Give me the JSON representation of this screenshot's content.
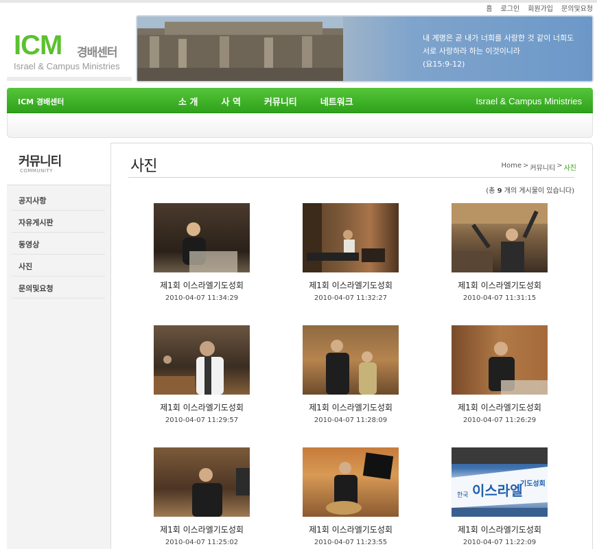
{
  "top_links": [
    "홈",
    "로그인",
    "회원가입",
    "문의및요청"
  ],
  "logo": {
    "main": "ICM",
    "korean": "경배센터",
    "english": "Israel & Campus Ministries"
  },
  "banner": {
    "verse_line1": "내 계명은 곧 내가 너희를 사랑한 것 같이 너희도",
    "verse_line2": "서로 사랑하라 하는 이것이니라",
    "verse_ref": "(요15:9-12)"
  },
  "nav": {
    "site": "ICM 경배센터",
    "menu": [
      "소 개",
      "사 역",
      "커뮤니티",
      "네트워크"
    ],
    "right": "Israel & Campus Ministries"
  },
  "sidebar": {
    "title": "커뮤니티",
    "subtitle": "COMMUNITY",
    "items": [
      "공지사항",
      "자유게시판",
      "동영상",
      "사진",
      "문의및요청"
    ]
  },
  "page": {
    "title": "사진",
    "breadcrumb": [
      "Home",
      "커뮤니티",
      "사진"
    ],
    "count_prefix": "(총",
    "count": "9",
    "count_suffix": "개의 게시물이 있습니다)"
  },
  "photos": [
    {
      "caption": "제1회 이스라엘기도성회",
      "date": "2010-04-07 11:34:29"
    },
    {
      "caption": "제1회 이스라엘기도성회",
      "date": "2010-04-07 11:32:27"
    },
    {
      "caption": "제1회 이스라엘기도성회",
      "date": "2010-04-07 11:31:15"
    },
    {
      "caption": "제1회 이스라엘기도성회",
      "date": "2010-04-07 11:29:57"
    },
    {
      "caption": "제1회 이스라엘기도성회",
      "date": "2010-04-07 11:28:09"
    },
    {
      "caption": "제1회 이스라엘기도성회",
      "date": "2010-04-07 11:26:29"
    },
    {
      "caption": "제1회 이스라엘기도성회",
      "date": "2010-04-07 11:25:02"
    },
    {
      "caption": "제1회 이스라엘기도성회",
      "date": "2010-04-07 11:23:55"
    },
    {
      "caption": "제1회 이스라엘기도성회",
      "date": "2010-04-07 11:22:09"
    }
  ],
  "thumb_banner_text": {
    "small": "한국",
    "big": "이스라엘",
    "tail": "기도성회"
  },
  "colors": {
    "brand_green": "#3db324",
    "logo_green": "#5bc12f",
    "breadcrumb_current": "#3a9f1e"
  }
}
